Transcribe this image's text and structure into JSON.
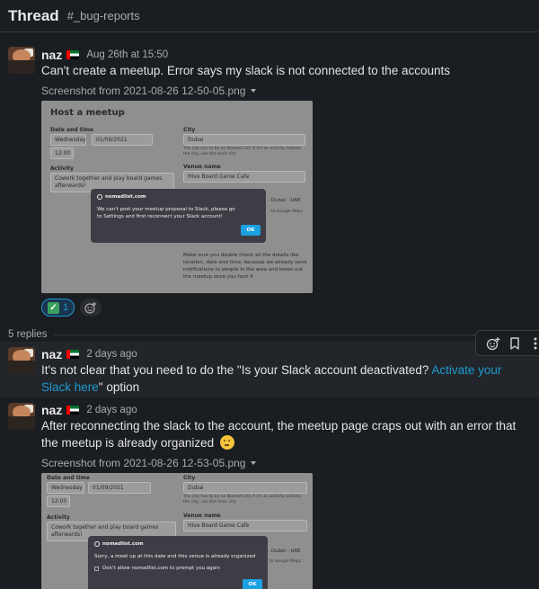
{
  "header": {
    "title": "Thread",
    "channel": "#_bug-reports"
  },
  "parent": {
    "author": "naz",
    "time": "Aug 26th at 15:50",
    "text": "Can't create a meetup. Error says my slack is not connected to the accounts",
    "file": {
      "name": "Screenshot from 2021-08-26 12-50-05.png",
      "form": {
        "heading": "Host a meetup",
        "date_label": "Date and time",
        "day": "Wednesday",
        "date": "01/09/2021",
        "time": "12:00",
        "city_label": "City",
        "city": "Dubai",
        "city_note": "The city has to be on Nomad List; if it's an activity outside the city, use the main city",
        "activity_label": "Activity",
        "activity": "Cowork together and play board games afterwards!",
        "venue_label": "Venue name",
        "venue": "Hive Board Game Cafe",
        "venue_partial": "- Dubai - UAE",
        "venue_maps": "to Google Maps",
        "bottom_note": "Make sure you double check all the details like location, date and time, because we already send notifications to people in the area and tweet out the meetup once you host it",
        "dialog_site": "nomadlist.com",
        "dialog_text": "We can't post your meetup proposal to Slack, please go to Settings and first reconnect your Slack account!",
        "dialog_ok": "OK"
      }
    },
    "reactions": [
      {
        "emoji": "white-check-mark",
        "count": "1"
      }
    ]
  },
  "replies_label": "5 replies",
  "replies": [
    {
      "author": "naz",
      "time": "2 days ago",
      "text_before": "It's not clear that you need to do the \"Is your Slack account deactivated? ",
      "link": "Activate your Slack here",
      "text_after": "\" option"
    },
    {
      "author": "naz",
      "time": "2 days ago",
      "text": "After reconnecting the slack to the account, the meetup page craps out with an error that the meetup is already organized",
      "file": {
        "name": "Screenshot from 2021-08-26 12-53-05.png",
        "form": {
          "date_label": "Date and time",
          "day": "Wednesday",
          "date": "01/09/2021",
          "time": "12:00",
          "city_label": "City",
          "city": "Dubai",
          "city_note": "The city has to be on Nomad List; if it's an activity outside the city, use the main city",
          "activity_label": "Activity",
          "activity": "Cowork together and play board games afterwards!",
          "venue_label": "Venue name",
          "venue": "Hive Board Game Cafe",
          "venue_partial": "- Dubai - UAE",
          "venue_maps": "to Google Maps",
          "dialog_site": "nomadlist.com",
          "dialog_text": "Sorry, a meet up at this date and this venue is already organized",
          "dialog_checkbox": "Don't allow nomadlist.com to prompt you again",
          "dialog_ok": "OK"
        }
      }
    }
  ]
}
